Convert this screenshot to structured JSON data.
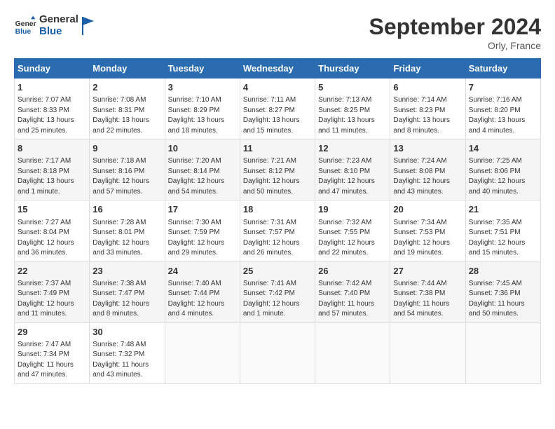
{
  "header": {
    "logo_line1": "General",
    "logo_line2": "Blue",
    "month_year": "September 2024",
    "location": "Orly, France"
  },
  "days_of_week": [
    "Sunday",
    "Monday",
    "Tuesday",
    "Wednesday",
    "Thursday",
    "Friday",
    "Saturday"
  ],
  "weeks": [
    [
      {
        "day": "1",
        "info": "Sunrise: 7:07 AM\nSunset: 8:33 PM\nDaylight: 13 hours\nand 25 minutes."
      },
      {
        "day": "2",
        "info": "Sunrise: 7:08 AM\nSunset: 8:31 PM\nDaylight: 13 hours\nand 22 minutes."
      },
      {
        "day": "3",
        "info": "Sunrise: 7:10 AM\nSunset: 8:29 PM\nDaylight: 13 hours\nand 18 minutes."
      },
      {
        "day": "4",
        "info": "Sunrise: 7:11 AM\nSunset: 8:27 PM\nDaylight: 13 hours\nand 15 minutes."
      },
      {
        "day": "5",
        "info": "Sunrise: 7:13 AM\nSunset: 8:25 PM\nDaylight: 13 hours\nand 11 minutes."
      },
      {
        "day": "6",
        "info": "Sunrise: 7:14 AM\nSunset: 8:23 PM\nDaylight: 13 hours\nand 8 minutes."
      },
      {
        "day": "7",
        "info": "Sunrise: 7:16 AM\nSunset: 8:20 PM\nDaylight: 13 hours\nand 4 minutes."
      }
    ],
    [
      {
        "day": "8",
        "info": "Sunrise: 7:17 AM\nSunset: 8:18 PM\nDaylight: 13 hours\nand 1 minute."
      },
      {
        "day": "9",
        "info": "Sunrise: 7:18 AM\nSunset: 8:16 PM\nDaylight: 12 hours\nand 57 minutes."
      },
      {
        "day": "10",
        "info": "Sunrise: 7:20 AM\nSunset: 8:14 PM\nDaylight: 12 hours\nand 54 minutes."
      },
      {
        "day": "11",
        "info": "Sunrise: 7:21 AM\nSunset: 8:12 PM\nDaylight: 12 hours\nand 50 minutes."
      },
      {
        "day": "12",
        "info": "Sunrise: 7:23 AM\nSunset: 8:10 PM\nDaylight: 12 hours\nand 47 minutes."
      },
      {
        "day": "13",
        "info": "Sunrise: 7:24 AM\nSunset: 8:08 PM\nDaylight: 12 hours\nand 43 minutes."
      },
      {
        "day": "14",
        "info": "Sunrise: 7:25 AM\nSunset: 8:06 PM\nDaylight: 12 hours\nand 40 minutes."
      }
    ],
    [
      {
        "day": "15",
        "info": "Sunrise: 7:27 AM\nSunset: 8:04 PM\nDaylight: 12 hours\nand 36 minutes."
      },
      {
        "day": "16",
        "info": "Sunrise: 7:28 AM\nSunset: 8:01 PM\nDaylight: 12 hours\nand 33 minutes."
      },
      {
        "day": "17",
        "info": "Sunrise: 7:30 AM\nSunset: 7:59 PM\nDaylight: 12 hours\nand 29 minutes."
      },
      {
        "day": "18",
        "info": "Sunrise: 7:31 AM\nSunset: 7:57 PM\nDaylight: 12 hours\nand 26 minutes."
      },
      {
        "day": "19",
        "info": "Sunrise: 7:32 AM\nSunset: 7:55 PM\nDaylight: 12 hours\nand 22 minutes."
      },
      {
        "day": "20",
        "info": "Sunrise: 7:34 AM\nSunset: 7:53 PM\nDaylight: 12 hours\nand 19 minutes."
      },
      {
        "day": "21",
        "info": "Sunrise: 7:35 AM\nSunset: 7:51 PM\nDaylight: 12 hours\nand 15 minutes."
      }
    ],
    [
      {
        "day": "22",
        "info": "Sunrise: 7:37 AM\nSunset: 7:49 PM\nDaylight: 12 hours\nand 11 minutes."
      },
      {
        "day": "23",
        "info": "Sunrise: 7:38 AM\nSunset: 7:47 PM\nDaylight: 12 hours\nand 8 minutes."
      },
      {
        "day": "24",
        "info": "Sunrise: 7:40 AM\nSunset: 7:44 PM\nDaylight: 12 hours\nand 4 minutes."
      },
      {
        "day": "25",
        "info": "Sunrise: 7:41 AM\nSunset: 7:42 PM\nDaylight: 12 hours\nand 1 minute."
      },
      {
        "day": "26",
        "info": "Sunrise: 7:42 AM\nSunset: 7:40 PM\nDaylight: 11 hours\nand 57 minutes."
      },
      {
        "day": "27",
        "info": "Sunrise: 7:44 AM\nSunset: 7:38 PM\nDaylight: 11 hours\nand 54 minutes."
      },
      {
        "day": "28",
        "info": "Sunrise: 7:45 AM\nSunset: 7:36 PM\nDaylight: 11 hours\nand 50 minutes."
      }
    ],
    [
      {
        "day": "29",
        "info": "Sunrise: 7:47 AM\nSunset: 7:34 PM\nDaylight: 11 hours\nand 47 minutes."
      },
      {
        "day": "30",
        "info": "Sunrise: 7:48 AM\nSunset: 7:32 PM\nDaylight: 11 hours\nand 43 minutes."
      },
      {
        "day": "",
        "info": ""
      },
      {
        "day": "",
        "info": ""
      },
      {
        "day": "",
        "info": ""
      },
      {
        "day": "",
        "info": ""
      },
      {
        "day": "",
        "info": ""
      }
    ]
  ]
}
